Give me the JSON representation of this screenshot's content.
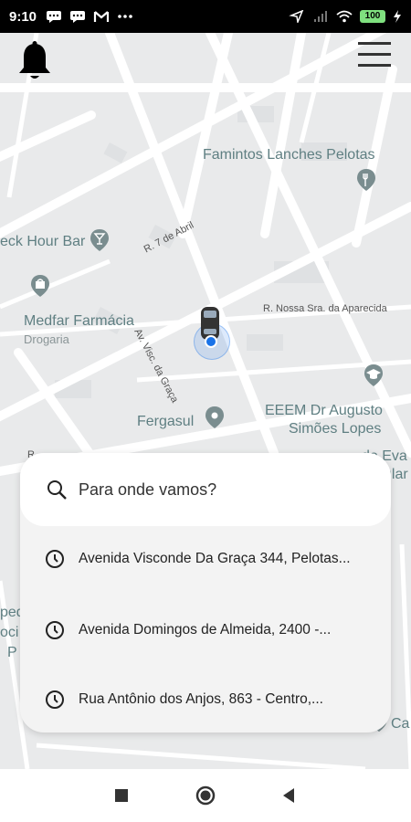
{
  "status_bar": {
    "time": "9:10",
    "battery": "100"
  },
  "map": {
    "pois": [
      {
        "name": "Famintos Lanches Pelotas",
        "icon": "restaurant-icon"
      },
      {
        "name": "eck Hour Bar",
        "icon": "bar-icon"
      },
      {
        "name": "Medfar Farmácia",
        "sub": "Drogaria",
        "icon": "shopping-bag-icon"
      },
      {
        "name": "Fergasul",
        "icon": "place-icon"
      },
      {
        "name": "EEEM Dr Augusto",
        "name2": "Simões Lopes",
        "icon": "school-icon"
      },
      {
        "name": "do Eva"
      },
      {
        "name": "ular"
      },
      {
        "name": "Ca"
      },
      {
        "name": "ped"
      },
      {
        "name": "oci"
      },
      {
        "name": "P"
      }
    ],
    "streets": {
      "r7abril": "R. 7 de Abril",
      "nossa_sra": "R. Nossa Sra. da Aparecida",
      "visc_graca": "Av. Visc. da Graça",
      "r": "R"
    }
  },
  "search": {
    "placeholder": "Para onde vamos?"
  },
  "recents": [
    "Avenida Visconde Da Graça 344, Pelotas...",
    "Avenida Domingos de Almeida, 2400 -...",
    "Rua Antônio dos Anjos, 863 - Centro,..."
  ],
  "colors": {
    "map_bg": "#e9eaeb",
    "poi_text": "#5f7f82",
    "location_dot": "#1a73e8"
  }
}
